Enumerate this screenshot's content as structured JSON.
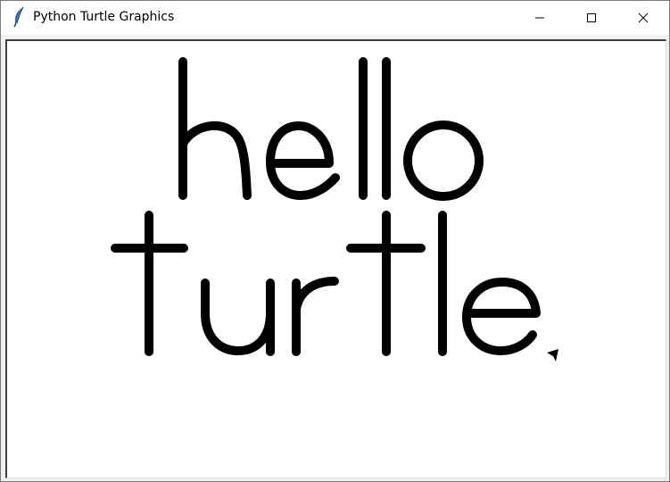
{
  "window": {
    "title": "Python Turtle Graphics",
    "icon": "feather-icon"
  },
  "controls": {
    "minimize_icon": "minimize-icon",
    "maximize_icon": "maximize-icon",
    "close_icon": "close-icon"
  },
  "canvas": {
    "background": "#ffffff",
    "pen_color": "#000000",
    "lines": [
      "hello",
      "turtle"
    ],
    "cursor_icon": "turtle-arrow-icon"
  }
}
